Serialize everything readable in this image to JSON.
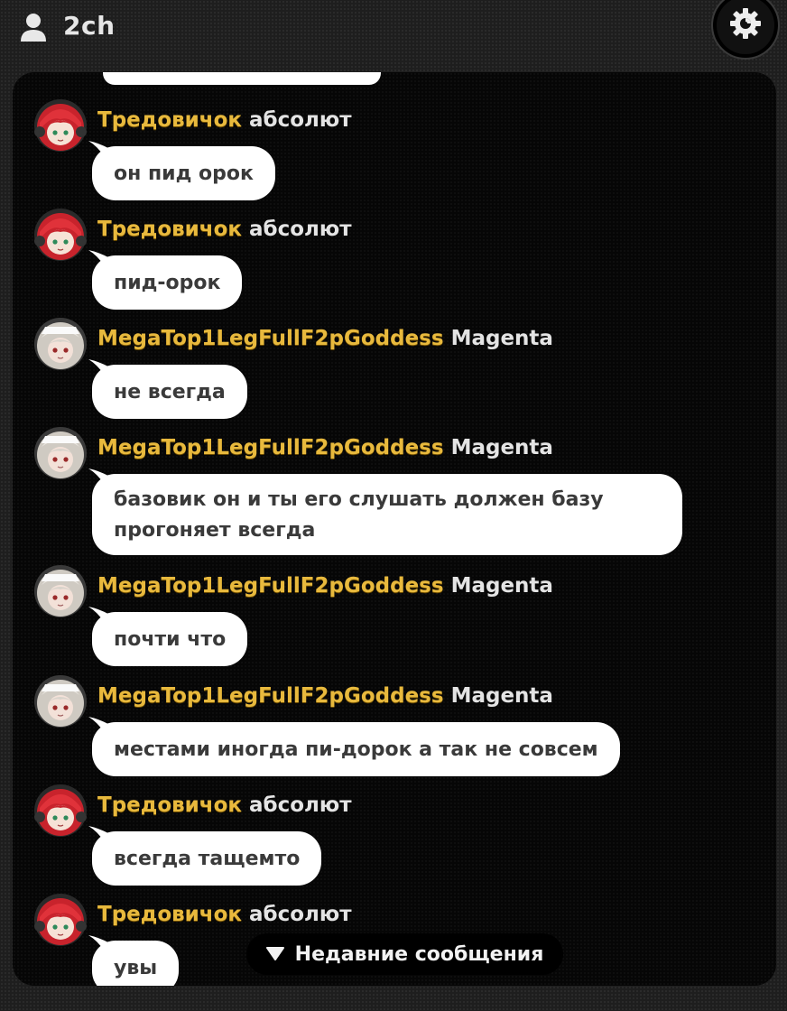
{
  "header": {
    "channel_name": "2ch",
    "user_icon": "user-icon",
    "settings_icon": "gear-icon"
  },
  "messages": [
    {
      "username": "Тредовичок",
      "tag": "абсолют",
      "text": "он пид орок",
      "avatar": "red-hair-avatar"
    },
    {
      "username": "Тредовичок",
      "tag": "абсолют",
      "text": "пид-орок",
      "avatar": "red-hair-avatar"
    },
    {
      "username": "MegaTop1LegFullF2pGoddess",
      "tag": "Magenta",
      "text": "не всегда",
      "avatar": "silver-hair-avatar"
    },
    {
      "username": "MegaTop1LegFullF2pGoddess",
      "tag": "Magenta",
      "text": "базовик он и ты его слушать должен базу прогоняет всегда",
      "avatar": "silver-hair-avatar"
    },
    {
      "username": "MegaTop1LegFullF2pGoddess",
      "tag": "Magenta",
      "text": "почти что",
      "avatar": "silver-hair-avatar"
    },
    {
      "username": "MegaTop1LegFullF2pGoddess",
      "tag": "Magenta",
      "text": "местами иногда пи-дорок а так не совсем",
      "avatar": "silver-hair-avatar"
    },
    {
      "username": "Тредовичок",
      "tag": "абсолют",
      "text": "всегда тащемто",
      "avatar": "red-hair-avatar"
    },
    {
      "username": "Тредовичок",
      "tag": "абсолют",
      "text": "увы",
      "avatar": "red-hair-avatar"
    }
  ],
  "recent_button": {
    "label": "Недавние сообщения",
    "icon": "triangle-down-icon"
  },
  "colors": {
    "username": "#e8b93d",
    "bubble": "#ffffff",
    "panel": "#060606",
    "background": "#1e1e1e"
  }
}
